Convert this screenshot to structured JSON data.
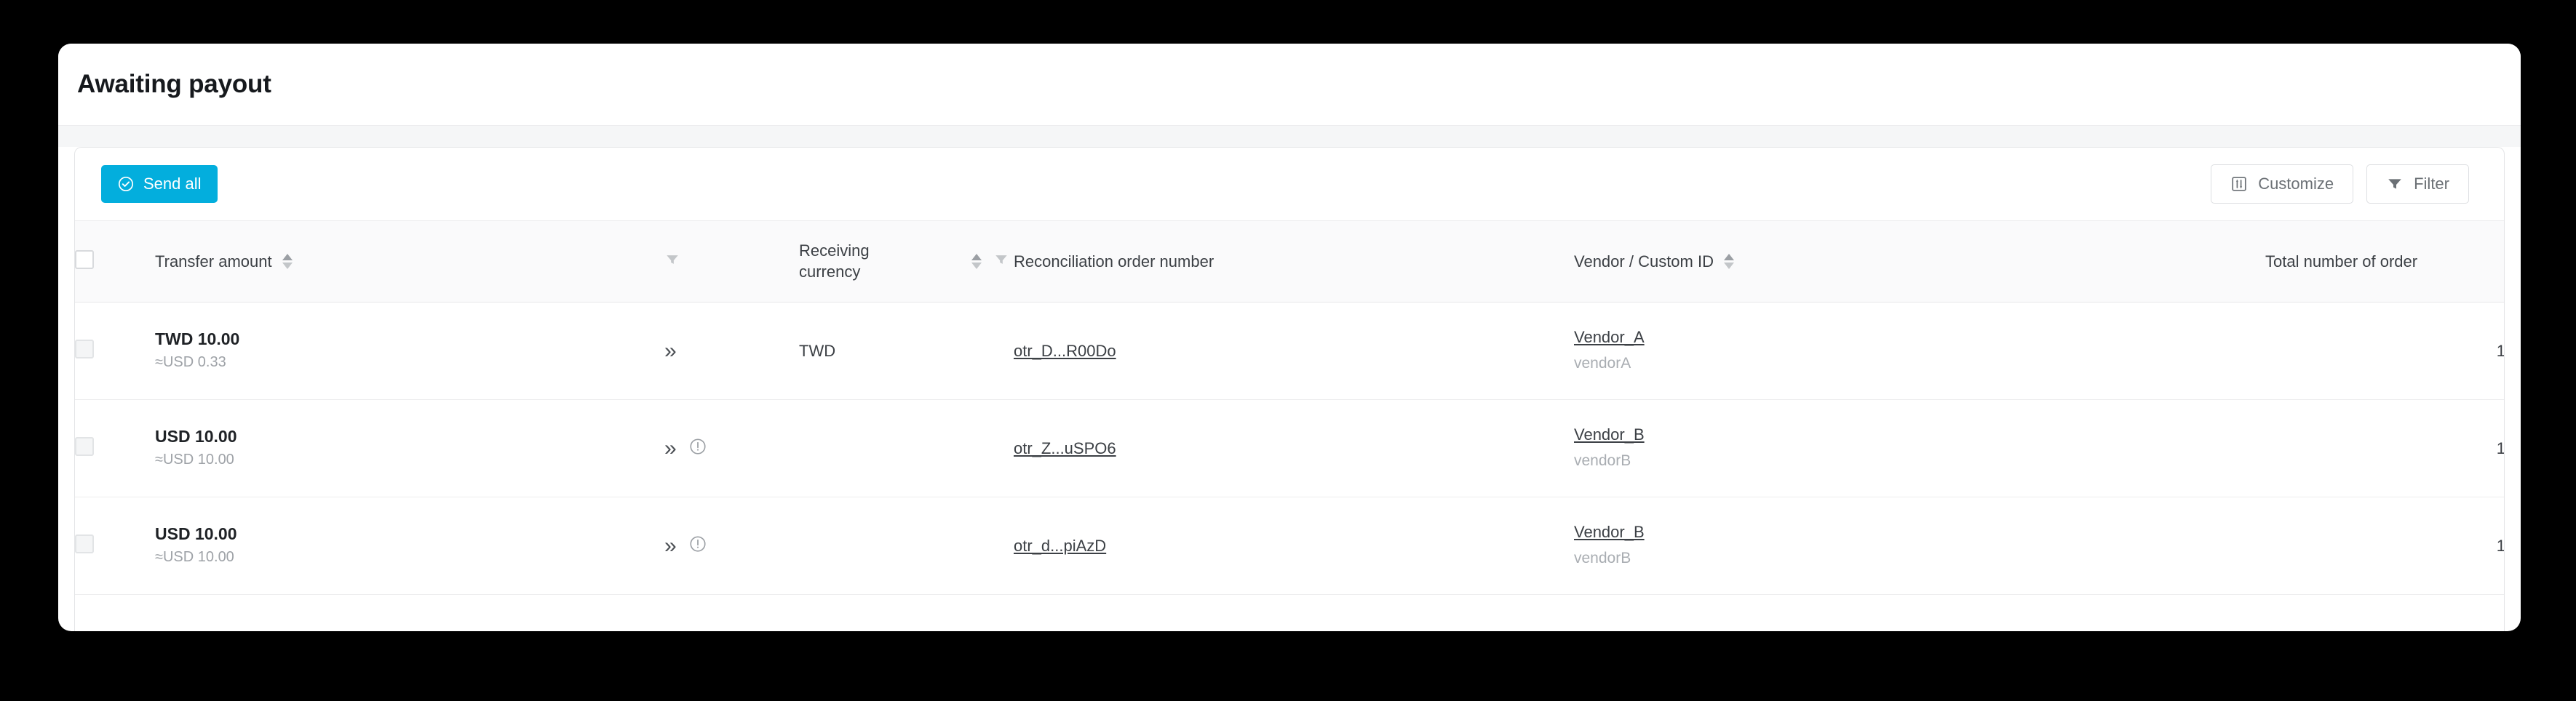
{
  "page": {
    "title": "Awaiting payout"
  },
  "colors": {
    "accent": "#03aedd",
    "card_bg": "#ffffff",
    "band_bg": "#f5f6f7",
    "header_bg": "#fafafb",
    "text": "#3c4045",
    "muted": "#9ea2a7",
    "border": "#ededee"
  },
  "toolbar": {
    "send_all_label": "Send all",
    "send_all_icon": "check-circle-icon",
    "customize_label": "Customize",
    "customize_icon": "sliders-icon",
    "filter_label": "Filter",
    "filter_icon": "funnel-icon"
  },
  "table": {
    "select_all_checkbox": false,
    "columns": [
      {
        "key": "select",
        "label": "",
        "sortable": false,
        "filterable": false,
        "align": "left"
      },
      {
        "key": "amount",
        "label": "Transfer amount",
        "sortable": true,
        "filterable": true,
        "align": "left"
      },
      {
        "key": "expand",
        "label": "",
        "sortable": false,
        "filterable": false,
        "align": "left"
      },
      {
        "key": "currency",
        "label": "Receiving currency",
        "sortable": true,
        "filterable": true,
        "align": "left"
      },
      {
        "key": "order",
        "label": "Reconciliation order number",
        "sortable": false,
        "filterable": false,
        "align": "left"
      },
      {
        "key": "vendor",
        "label": "Vendor / Custom ID",
        "sortable": true,
        "filterable": false,
        "align": "left"
      },
      {
        "key": "total",
        "label": "Total number of order",
        "sortable": false,
        "filterable": false,
        "align": "right"
      }
    ],
    "header": {
      "transfer_amount": "Transfer amount",
      "receiving_currency_line1": "Receiving",
      "receiving_currency_line2": "currency",
      "reconciliation_order_number": "Reconciliation order number",
      "vendor_custom_id": "Vendor / Custom ID",
      "total_number_of_order": "Total number of order"
    },
    "rows": [
      {
        "selected": false,
        "amount": "TWD 10.00",
        "amount_converted": "≈USD 0.33",
        "expand_icon": "double-chevron-right-icon",
        "has_warning": false,
        "receiving_currency": "TWD",
        "order_number": "otr_D...R00Do",
        "vendor_name": "Vendor_A",
        "vendor_id": "vendorA",
        "total_orders": "1"
      },
      {
        "selected": false,
        "amount": "USD 10.00",
        "amount_converted": "≈USD 10.00",
        "expand_icon": "double-chevron-right-icon",
        "has_warning": true,
        "warning_icon": "exclamation-circle-icon",
        "receiving_currency": "",
        "order_number": "otr_Z...uSPO6",
        "vendor_name": "Vendor_B",
        "vendor_id": "vendorB",
        "total_orders": "1"
      },
      {
        "selected": false,
        "amount": "USD 10.00",
        "amount_converted": "≈USD 10.00",
        "expand_icon": "double-chevron-right-icon",
        "has_warning": true,
        "warning_icon": "exclamation-circle-icon",
        "receiving_currency": "",
        "order_number": "otr_d...piAzD",
        "vendor_name": "Vendor_B",
        "vendor_id": "vendorB",
        "total_orders": "1"
      }
    ]
  }
}
